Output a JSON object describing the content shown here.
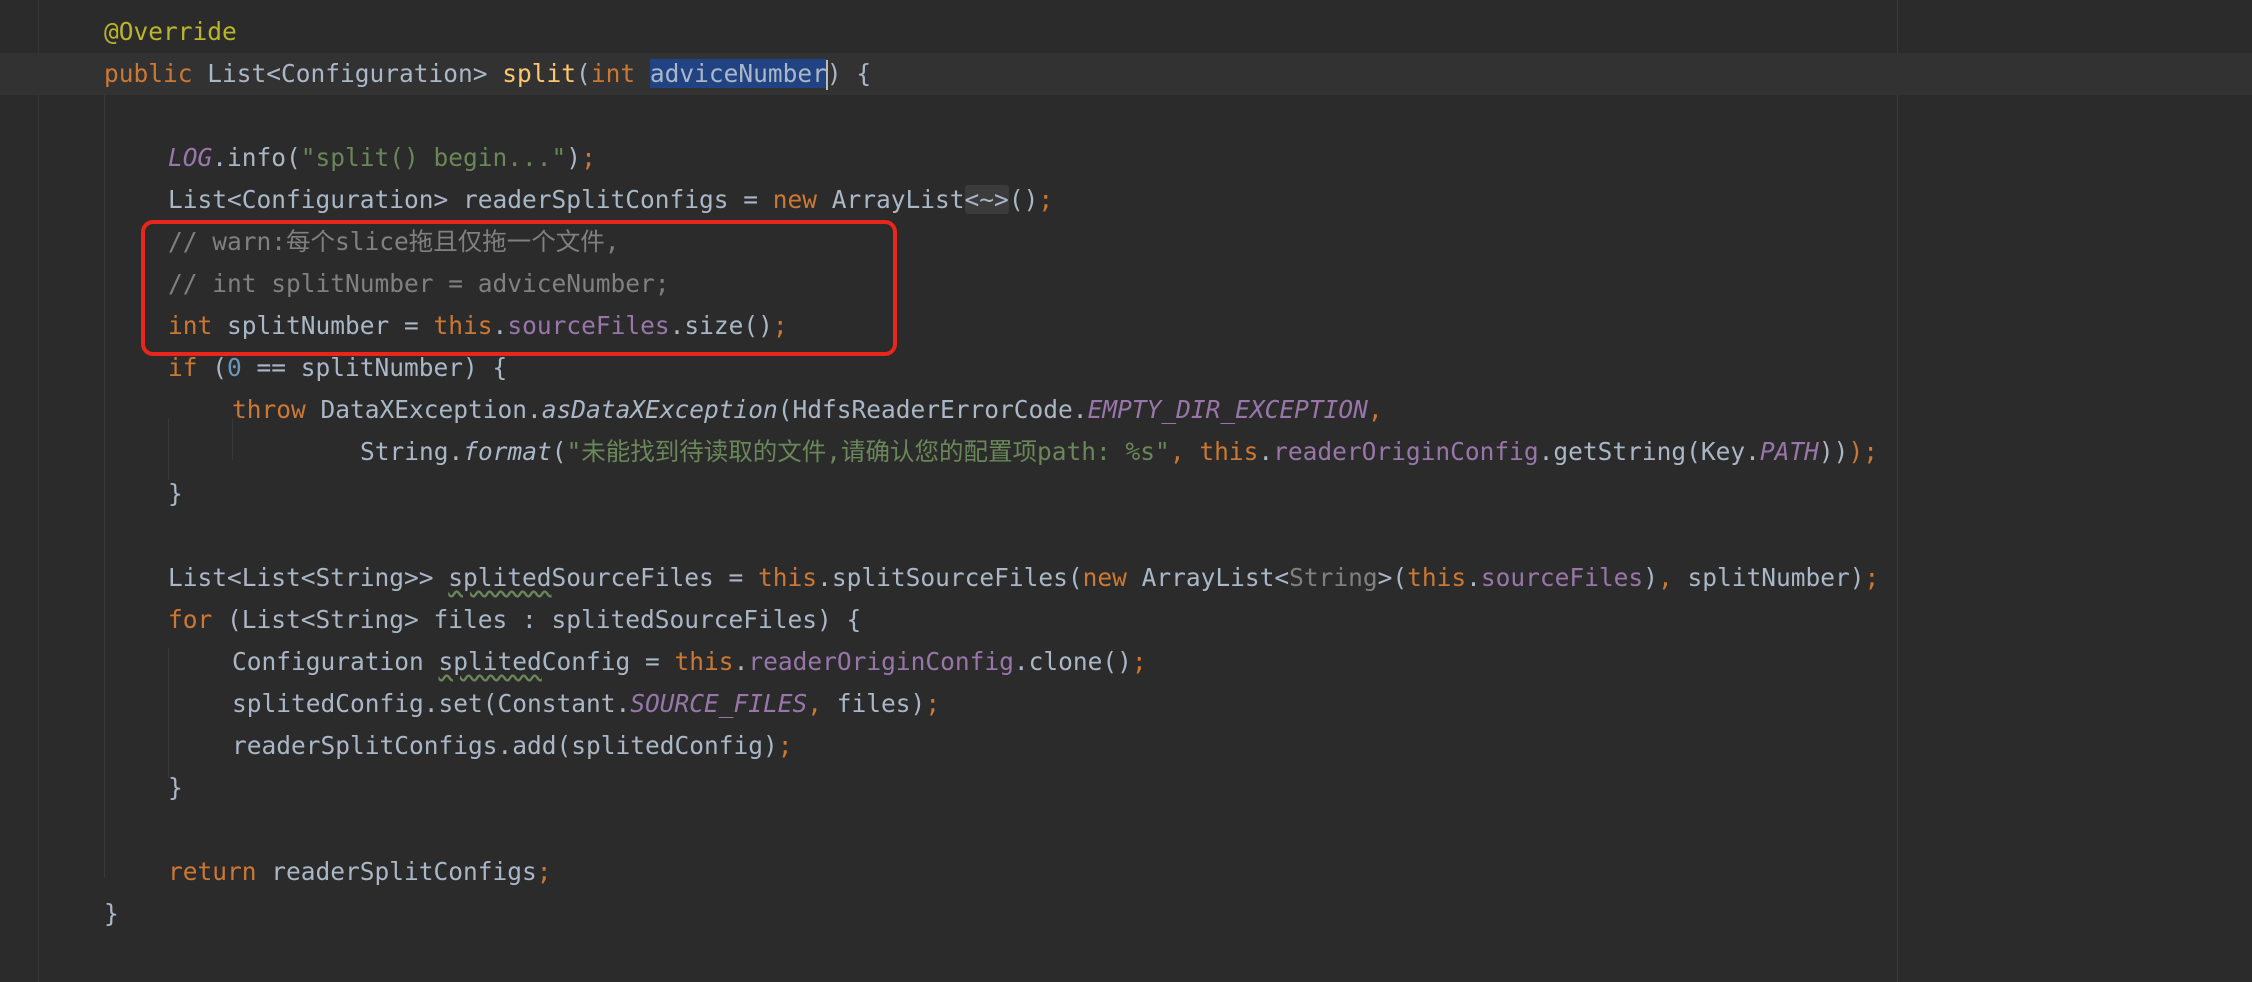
{
  "editor": {
    "lines": [
      {
        "text": "@Override"
      },
      {
        "text": "public List<Configuration> split(int adviceNumber) {"
      },
      {
        "text": ""
      },
      {
        "text": "LOG.info(\"split() begin...\");"
      },
      {
        "text": "List<Configuration> readerSplitConfigs = new ArrayList<~>();"
      },
      {
        "text": "// warn:每个slice拖且仅拖一个文件,"
      },
      {
        "text": "// int splitNumber = adviceNumber;"
      },
      {
        "text": "int splitNumber = this.sourceFiles.size();"
      },
      {
        "text": "if (0 == splitNumber) {"
      },
      {
        "text": "throw DataXException.asDataXException(HdfsReaderErrorCode.EMPTY_DIR_EXCEPTION,"
      },
      {
        "text": "String.format(\"未能找到待读取的文件,请确认您的配置项path: %s\", this.readerOriginConfig.getString(Key.PATH)));"
      },
      {
        "text": "}"
      },
      {
        "text": ""
      },
      {
        "text": "List<List<String>> splitedSourceFiles = this.splitSourceFiles(new ArrayList<String>(this.sourceFiles), splitNumber);"
      },
      {
        "text": "for (List<String> files : splitedSourceFiles) {"
      },
      {
        "text": "Configuration splitedConfig = this.readerOriginConfig.clone();"
      },
      {
        "text": "splitedConfig.set(Constant.SOURCE_FILES, files);"
      },
      {
        "text": "readerSplitConfigs.add(splitedConfig);"
      },
      {
        "text": "}"
      },
      {
        "text": ""
      },
      {
        "text": "return readerSplitConfigs;"
      },
      {
        "text": "}"
      }
    ],
    "selected_identifier": "adviceNumber",
    "gutter_icon": "lightbulb-icon"
  },
  "colors": {
    "background": "#2b2b2b",
    "keyword": "#cc7832",
    "annotation": "#bbb529",
    "method_declaration": "#ffc66d",
    "string": "#6a8759",
    "comment": "#808080",
    "field": "#9876aa",
    "selection": "#214283",
    "highlight_box": "#e8261c"
  }
}
